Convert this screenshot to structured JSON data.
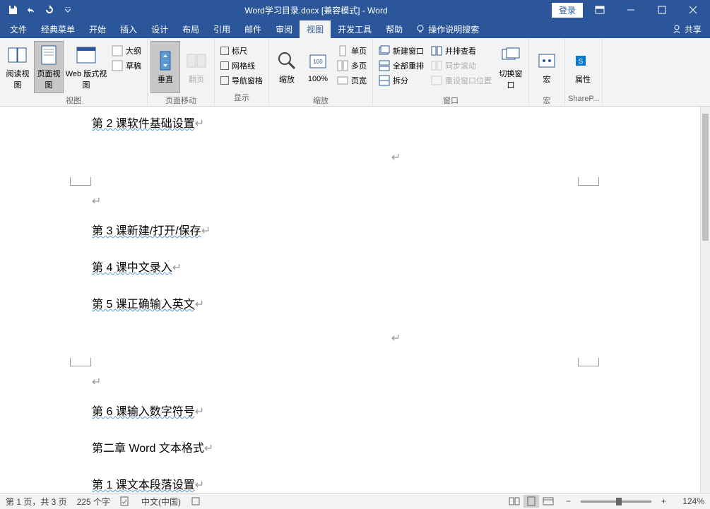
{
  "title": "Word学习目录.docx [兼容模式] - Word",
  "qat": {
    "login": "登录"
  },
  "menu": {
    "file": "文件",
    "classic": "经典菜单",
    "home": "开始",
    "insert": "插入",
    "design": "设计",
    "layout": "布局",
    "references": "引用",
    "mail": "邮件",
    "review": "审阅",
    "view": "视图",
    "developer": "开发工具",
    "help": "帮助",
    "tellme": "操作说明搜索",
    "share": "共享"
  },
  "ribbon": {
    "views": {
      "label": "视图",
      "read": "阅读视图",
      "page": "页面视图",
      "web": "Web 版式视图",
      "outline": "大纲",
      "draft": "草稿"
    },
    "pagemove": {
      "label": "页面移动",
      "vertical": "垂直",
      "flip": "翻页"
    },
    "show": {
      "label": "显示",
      "ruler": "标尺",
      "gridlines": "网格线",
      "navpane": "导航窗格"
    },
    "zoom": {
      "label": "缩放",
      "zoom": "缩放",
      "hundred": "100%",
      "onepage": "单页",
      "multipage": "多页",
      "pagewidth": "页宽"
    },
    "window": {
      "label": "窗口",
      "newwin": "新建窗口",
      "arrange": "全部重排",
      "split": "拆分",
      "sidebyside": "并排查看",
      "syncscroll": "同步滚动",
      "reset": "重设窗口位置",
      "switch": "切换窗口"
    },
    "macros": {
      "label": "宏",
      "macro": "宏"
    },
    "sharepoint": {
      "label": "SharePoint",
      "props": "属性"
    }
  },
  "doc": {
    "l1": "第 2 课软件基础设置",
    "l2": "第 3 课新建/打开/保存",
    "l3": "第 4 课中文录入",
    "l4": "第 5 课正确输入英文",
    "l5": "第 6 课输入数字符号",
    "l6": "第二章 Word 文本格式",
    "l7": "第 1 课文本段落设置"
  },
  "status": {
    "page": "第 1 页，共 3 页",
    "words": "225 个字",
    "lang": "中文(中国)",
    "zoom": "124%"
  }
}
